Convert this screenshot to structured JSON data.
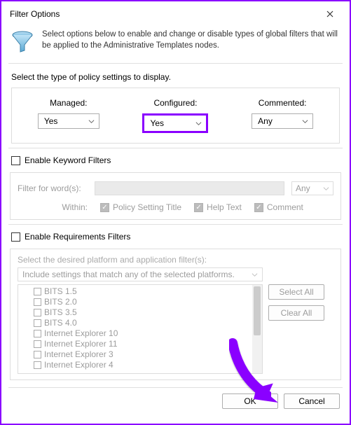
{
  "title": "Filter Options",
  "header_text": "Select options below to enable and change or disable types of global filters that will be applied to the Administrative Templates nodes.",
  "policy": {
    "prompt": "Select the type of policy settings to display.",
    "managed": {
      "label": "Managed:",
      "value": "Yes"
    },
    "configured": {
      "label": "Configured:",
      "value": "Yes"
    },
    "commented": {
      "label": "Commented:",
      "value": "Any"
    }
  },
  "keyword": {
    "enable": "Enable Keyword Filters",
    "filter_for": "Filter for word(s):",
    "match": "Any",
    "within": "Within:",
    "opt_title": "Policy Setting Title",
    "opt_help": "Help Text",
    "opt_comment": "Comment"
  },
  "requirements": {
    "enable": "Enable Requirements Filters",
    "desc": "Select the desired platform and application filter(s):",
    "mode": "Include settings that match any of the selected platforms.",
    "platforms": [
      "BITS 1.5",
      "BITS 2.0",
      "BITS 3.5",
      "BITS 4.0",
      "Internet Explorer 10",
      "Internet Explorer 11",
      "Internet Explorer 3",
      "Internet Explorer 4"
    ],
    "select_all": "Select All",
    "clear_all": "Clear All"
  },
  "buttons": {
    "ok": "OK",
    "cancel": "Cancel"
  }
}
